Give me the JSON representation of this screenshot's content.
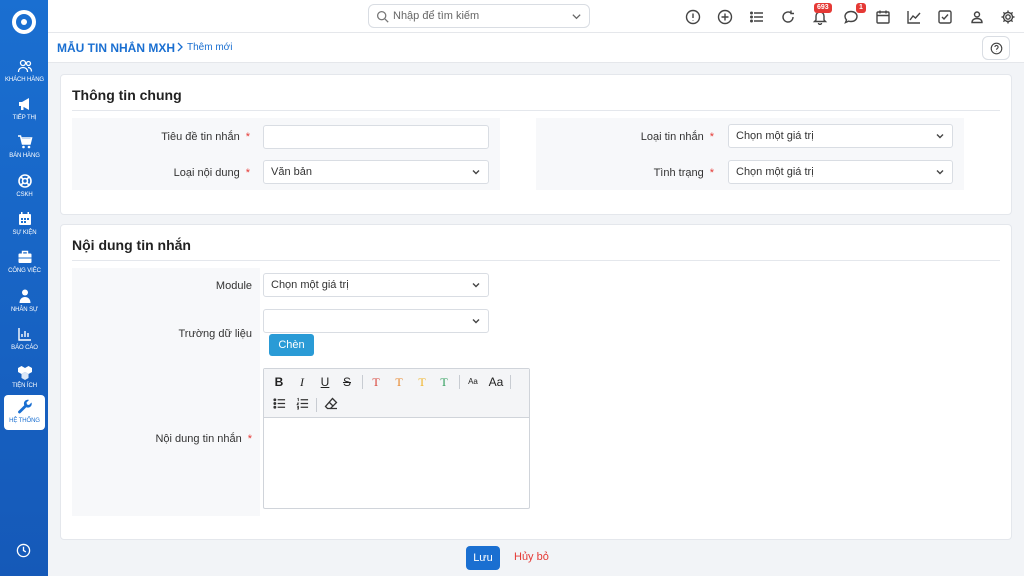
{
  "sidebar": {
    "items": [
      {
        "label": "Khách hàng",
        "icon": "users-icon"
      },
      {
        "label": "Tiếp thị",
        "icon": "megaphone-icon"
      },
      {
        "label": "Bán hàng",
        "icon": "cart-icon"
      },
      {
        "label": "CSKH",
        "icon": "lifebuoy-icon"
      },
      {
        "label": "Sự kiện",
        "icon": "calendar-icon"
      },
      {
        "label": "Công việc",
        "icon": "briefcase-icon"
      },
      {
        "label": "Nhân sự",
        "icon": "person-icon"
      },
      {
        "label": "Báo cáo",
        "icon": "report-icon"
      },
      {
        "label": "Tiện ích",
        "icon": "boxes-icon"
      },
      {
        "label": "Hệ thống",
        "icon": "wrench-icon"
      }
    ]
  },
  "topbar": {
    "search_placeholder": "Nhập để tìm kiếm",
    "notifications_count": "693",
    "messages_count": "1"
  },
  "breadcrumb": {
    "title": "MẪU TIN NHẮN MXH",
    "current": "Thêm mới"
  },
  "general": {
    "title": "Thông tin chung",
    "message_title_label": "Tiêu đề tin nhắn",
    "message_title_value": "",
    "content_type_label": "Loại nội dung",
    "content_type_value": "Văn bản",
    "message_type_label": "Loại tin nhắn",
    "message_type_value": "Chọn một giá trị",
    "status_label": "Tình trạng",
    "status_value": "Chọn một giá trị"
  },
  "content": {
    "title": "Nội dung tin nhắn",
    "module_label": "Module",
    "module_value": "Chọn một giá trị",
    "data_field_label": "Trường dữ liệu",
    "data_field_value": "",
    "insert_label": "Chèn",
    "message_content_label": "Nội dung tin nhắn"
  },
  "editor": {
    "bold": "B",
    "italic": "I",
    "underline": "U",
    "strike": "S",
    "text_color_glyph": "T",
    "font_small": "Aa",
    "font_large": "Aa",
    "colors": [
      "#d9453b",
      "#e8872c",
      "#f0b429",
      "#2e9e5b"
    ]
  },
  "footer": {
    "save_label": "Lưu",
    "cancel_label": "Hủy bỏ"
  },
  "colors": {
    "primary": "#1a6fd1",
    "danger": "#e53935",
    "insert_button": "#2a9bd6"
  }
}
